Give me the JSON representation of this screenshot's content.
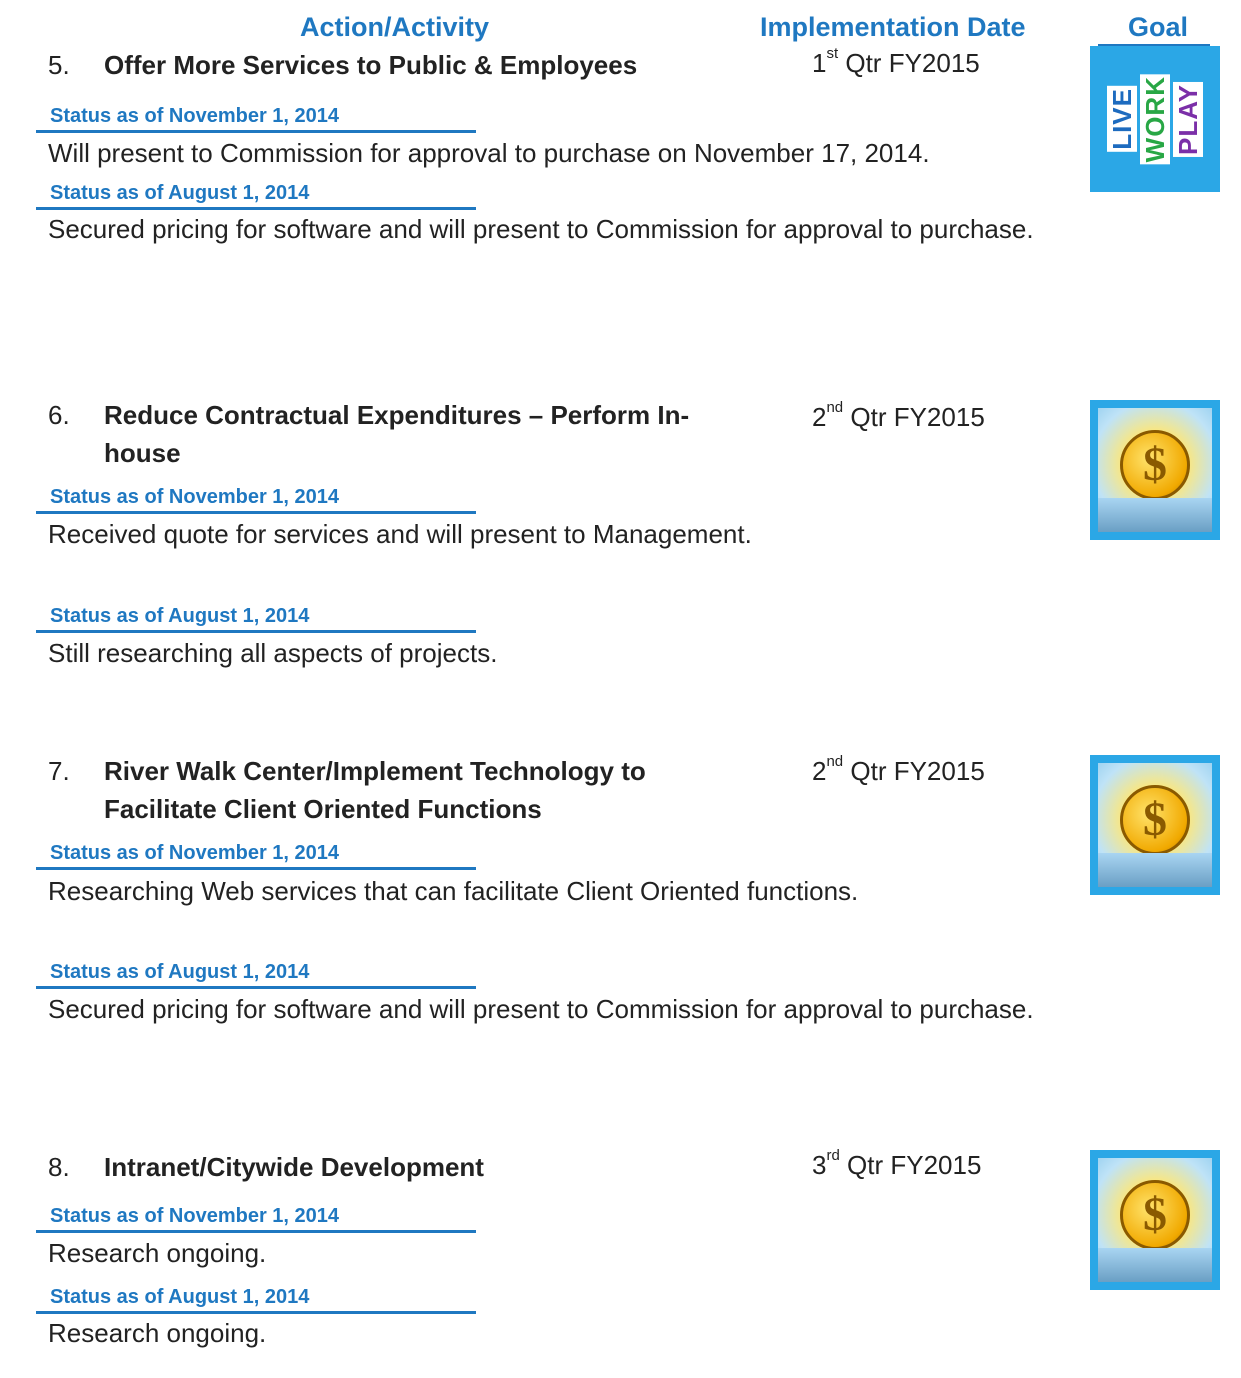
{
  "header": {
    "action": "Action/Activity",
    "implementation": "Implementation Date",
    "goal": "Goal"
  },
  "items": [
    {
      "number": "5.",
      "title": "Offer More Services to Public & Employees",
      "impl_num": "1",
      "impl_sup": "st",
      "impl_rest": " Qtr FY2015",
      "goal_icon": "live-work-play-icon",
      "goal_words": [
        "LIVE",
        "WORK",
        "PLAY"
      ],
      "statuses": [
        {
          "label": "Status as of November 1, 2014",
          "text": "Will present to Commission for approval to purchase on November 17, 2014."
        },
        {
          "label": "Status as of August 1, 2014",
          "text": "Secured pricing for software and will present to Commission for approval to purchase."
        }
      ]
    },
    {
      "number": "6.",
      "title": "Reduce Contractual Expenditures – Perform In-house",
      "impl_num": "2",
      "impl_sup": "nd",
      "impl_rest": " Qtr FY2015",
      "goal_icon": "economic-sun-coin-icon",
      "statuses": [
        {
          "label": "Status as of November 1, 2014",
          "text": "Received quote for services and will present to Management."
        },
        {
          "label": "Status as of August 1, 2014",
          "text": "Still researching all aspects of projects."
        }
      ]
    },
    {
      "number": "7.",
      "title": "River Walk Center/Implement Technology to Facilitate Client Oriented Functions",
      "impl_num": "2",
      "impl_sup": "nd",
      "impl_rest": " Qtr FY2015",
      "goal_icon": "economic-sun-coin-icon",
      "statuses": [
        {
          "label": "Status as of November 1, 2014",
          "text": "Researching Web services that can facilitate Client Oriented functions."
        },
        {
          "label": "Status as of August 1, 2014",
          "text": "Secured pricing for software and will present to Commission for approval to purchase."
        }
      ]
    },
    {
      "number": "8.",
      "title": "Intranet/Citywide Development",
      "impl_num": "3",
      "impl_sup": "rd",
      "impl_rest": " Qtr FY2015",
      "goal_icon": "economic-sun-coin-icon",
      "statuses": [
        {
          "label": "Status as of November 1, 2014",
          "text": "Research ongoing."
        },
        {
          "label": "Status as of August 1, 2014",
          "text": "Research ongoing."
        }
      ]
    }
  ],
  "colors": {
    "accent": "#1f78c1",
    "goal_frame": "#2ba7e6"
  }
}
